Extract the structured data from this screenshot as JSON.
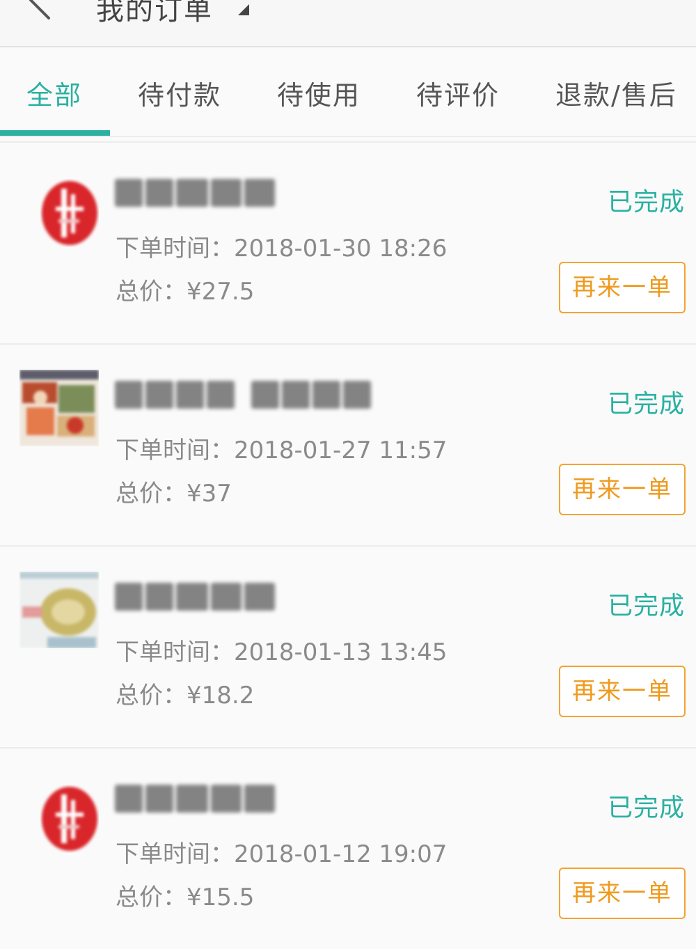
{
  "header": {
    "title": "我的订单",
    "back_icon": "back-arrow-icon",
    "caret_icon": "dropdown-caret-icon"
  },
  "tabs": [
    {
      "label": "全部",
      "active": true
    },
    {
      "label": "待付款",
      "active": false
    },
    {
      "label": "待使用",
      "active": false
    },
    {
      "label": "待评价",
      "active": false
    },
    {
      "label": "退款/售后",
      "active": false
    }
  ],
  "colors": {
    "accent": "#2ab1a1",
    "reorder": "#f2a431"
  },
  "orders": [
    {
      "status": "已完成",
      "time": "下单时间：2018-01-30 18:26",
      "total": "总价：¥27.5",
      "reorder_label": "再来一单"
    },
    {
      "status": "已完成",
      "time": "下单时间：2018-01-27 11:57",
      "total": "总价：¥37",
      "reorder_label": "再来一单"
    },
    {
      "status": "已完成",
      "time": "下单时间：2018-01-13 13:45",
      "total": "总价：¥18.2",
      "reorder_label": "再来一单"
    },
    {
      "status": "已完成",
      "time": "下单时间：2018-01-12 19:07",
      "total": "总价：¥15.5",
      "reorder_label": "再来一单"
    }
  ]
}
